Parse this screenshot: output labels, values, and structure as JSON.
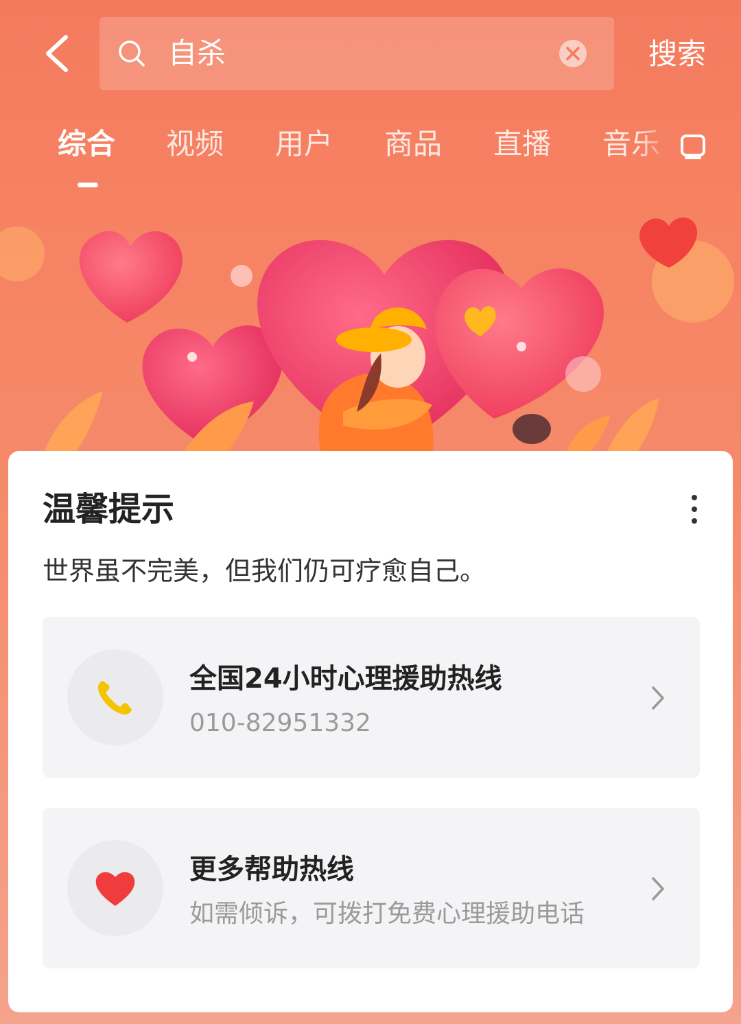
{
  "search": {
    "query": "自杀",
    "button_label": "搜索"
  },
  "tabs": [
    {
      "label": "综合",
      "active": true
    },
    {
      "label": "视频"
    },
    {
      "label": "用户"
    },
    {
      "label": "商品"
    },
    {
      "label": "直播"
    },
    {
      "label": "音乐"
    }
  ],
  "icons": {
    "back": "back-arrow-icon",
    "search": "search-icon",
    "clear": "clear-icon",
    "tab_more": "tab-more-icon",
    "more": "more-vertical-icon",
    "phone": "phone-icon",
    "heart": "heart-icon",
    "chevron": "chevron-right-icon"
  },
  "card": {
    "title": "温馨提示",
    "subtitle": "世界虽不完美，但我们仍可疗愈自己。",
    "items": [
      {
        "title": "全国24小时心理援助热线",
        "subtitle": "010-82951332",
        "icon": "phone-icon"
      },
      {
        "title": "更多帮助热线",
        "subtitle": "如需倾诉，可拨打免费心理援助电话",
        "icon": "heart-icon"
      }
    ]
  },
  "colors": {
    "header_bg": "#f47a5e",
    "phone_icon": "#f5c400",
    "heart_icon": "#f03c3c"
  }
}
